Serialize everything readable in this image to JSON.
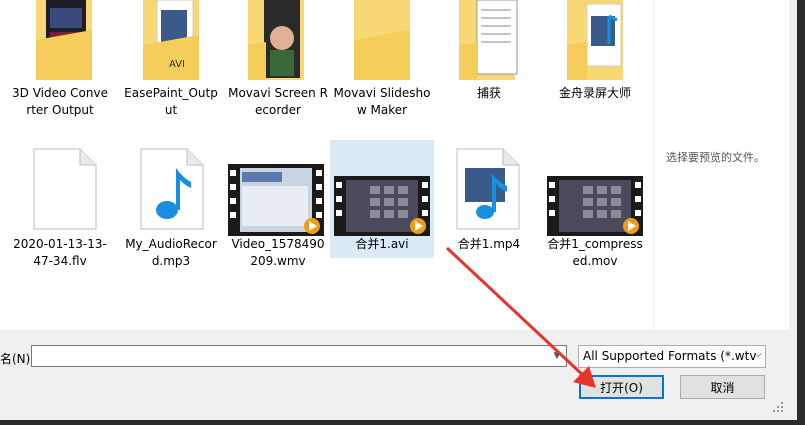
{
  "files": [
    {
      "label": "3D Video Converter Output",
      "icon": "folder-icon"
    },
    {
      "label": "EasePaint_Output",
      "icon": "folder-icon",
      "badge": "AVI"
    },
    {
      "label": "Movavi Screen Recorder",
      "icon": "folder-icon"
    },
    {
      "label": "Movavi Slideshow Maker",
      "icon": "folder-icon"
    },
    {
      "label": "捕获",
      "icon": "folder-icon"
    },
    {
      "label": "金舟录屏大师",
      "icon": "folder-icon"
    },
    {
      "label": "2020-01-13-13-47-34.flv",
      "icon": "blank-file-icon"
    },
    {
      "label": "My_AudioRecord.mp3",
      "icon": "audio-file-icon"
    },
    {
      "label": "Video_1578490209.wmv",
      "icon": "video-thumbnail-icon"
    },
    {
      "label": "合并1.avi",
      "icon": "video-thumbnail-icon",
      "selected": true
    },
    {
      "label": "合并1.mp4",
      "icon": "video-file-icon"
    },
    {
      "label": "合并1_compressed.mov",
      "icon": "video-thumbnail-icon"
    }
  ],
  "preview": {
    "text": "选择要预览的文件。"
  },
  "filename": {
    "label": "名(N):",
    "value": ""
  },
  "filter": {
    "selected": "All Supported Formats (*.wtv"
  },
  "buttons": {
    "open": "打开(O)",
    "cancel": "取消"
  },
  "colors": {
    "accent": "#0078d7",
    "folder": "#f8d775",
    "arrow": "#e8332a",
    "selection": "#dbeaf7"
  }
}
